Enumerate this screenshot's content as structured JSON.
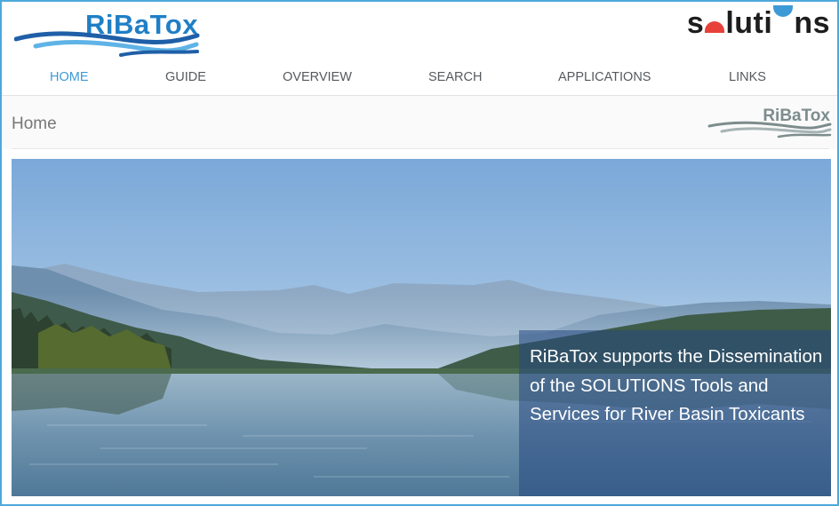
{
  "brand": {
    "name": "RiBaTox"
  },
  "partner": {
    "name_parts": [
      "s",
      "luti",
      "ns"
    ]
  },
  "nav": {
    "items": [
      {
        "label": "HOME",
        "active": true
      },
      {
        "label": "GUIDE",
        "active": false
      },
      {
        "label": "OVERVIEW",
        "active": false
      },
      {
        "label": "SEARCH",
        "active": false
      },
      {
        "label": "APPLICATIONS",
        "active": false
      },
      {
        "label": "LINKS",
        "active": false
      }
    ]
  },
  "page": {
    "title": "Home"
  },
  "small_logo": {
    "name": "RiBaTox"
  },
  "hero": {
    "caption": "RiBaTox supports the Dissemination of the SOLUTIONS Tools and Services for River Basin Toxicants"
  },
  "colors": {
    "frame_border": "#4ea8dc",
    "nav_active": "#3d9ad6",
    "nav_text": "#555a5e",
    "brand_blue": "#1f7fc6",
    "partner_red": "#e8413b",
    "partner_blue": "#3d9ad6",
    "caption_overlay": "#264880"
  }
}
